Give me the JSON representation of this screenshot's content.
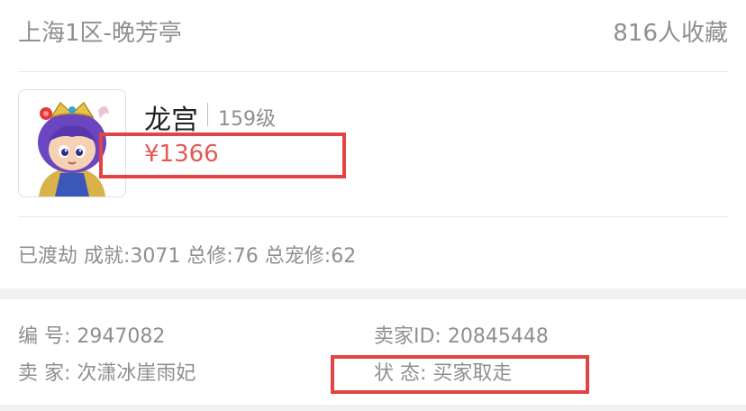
{
  "header": {
    "server": "上海1区-晚芳亭",
    "favorites": "816人收藏"
  },
  "character": {
    "name": "龙宫",
    "level": "159级",
    "price": "¥1366",
    "avatar_icon": "dragon-palace-character-avatar"
  },
  "stats": {
    "summary": "已渡劫 成就:3071 总修:76 总宠修:62"
  },
  "details": {
    "serial_label": "编 号:",
    "serial_value": "2947082",
    "seller_id_label": "卖家ID:",
    "seller_id_value": "20845448",
    "seller_label": "卖 家:",
    "seller_value": "次潇冰崖雨妃",
    "status_label": "状 态:",
    "status_value": "买家取走"
  },
  "colors": {
    "price": "#e05b55",
    "highlight_box": "#e24444",
    "muted_text": "#8f8f8f",
    "divider": "#e9e9e9"
  }
}
